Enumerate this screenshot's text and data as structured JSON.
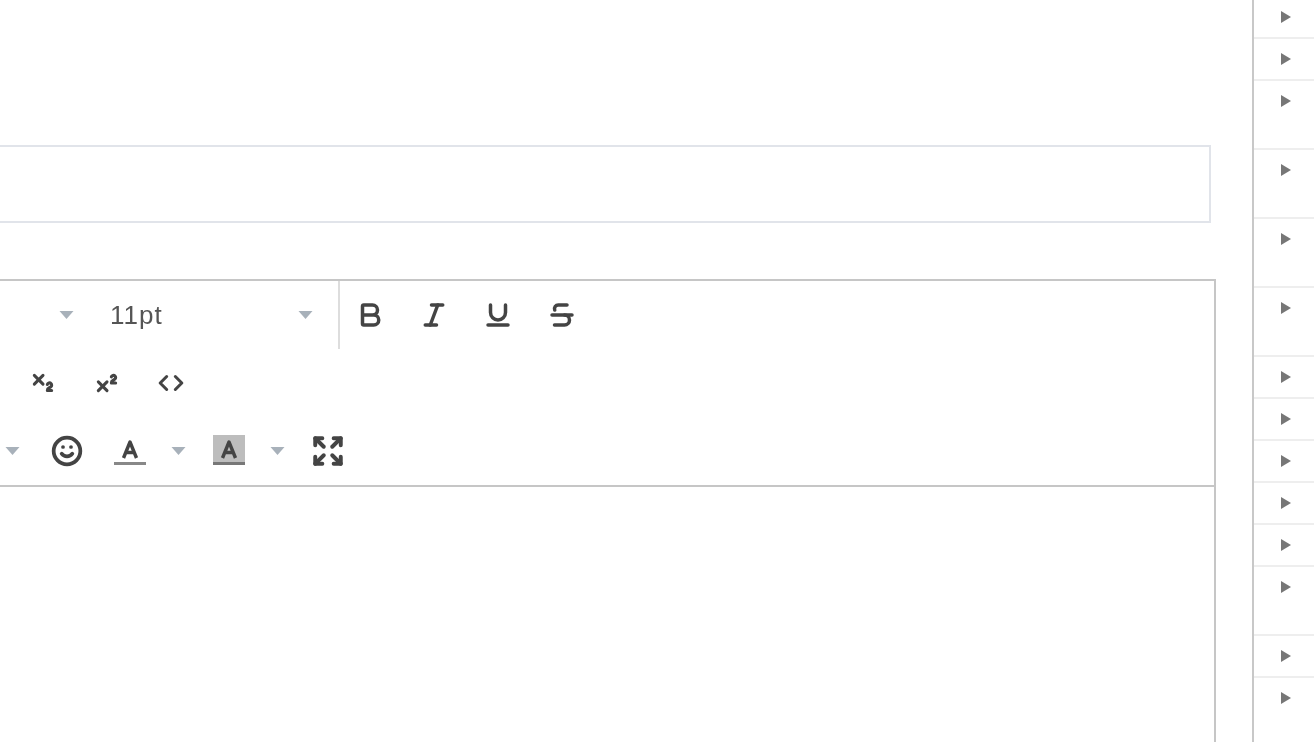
{
  "editor": {
    "toolbar": {
      "rows": [
        [
          {
            "kind": "caret"
          },
          {
            "kind": "select",
            "value": "11pt"
          },
          {
            "kind": "separator"
          },
          {
            "kind": "bold"
          },
          {
            "kind": "italic"
          },
          {
            "kind": "underline"
          },
          {
            "kind": "strikethrough"
          }
        ],
        [
          {
            "kind": "subscript"
          },
          {
            "kind": "superscript"
          },
          {
            "kind": "code"
          }
        ],
        [
          {
            "kind": "caret"
          },
          {
            "kind": "emoji"
          },
          {
            "kind": "text-color"
          },
          {
            "kind": "caret"
          },
          {
            "kind": "background-color"
          },
          {
            "kind": "caret"
          },
          {
            "kind": "fullscreen"
          }
        ]
      ]
    }
  },
  "tree": {
    "items": [
      {
        "kind": "single",
        "expanded": false
      },
      {
        "kind": "single",
        "expanded": false
      },
      {
        "kind": "double",
        "expanded": false
      },
      {
        "kind": "double",
        "expanded": false
      },
      {
        "kind": "double",
        "expanded": false
      },
      {
        "kind": "double",
        "expanded": false
      },
      {
        "kind": "single",
        "expanded": false
      },
      {
        "kind": "single",
        "expanded": false
      },
      {
        "kind": "single",
        "expanded": false
      },
      {
        "kind": "single",
        "expanded": false
      },
      {
        "kind": "single",
        "expanded": false
      },
      {
        "kind": "double",
        "expanded": false
      },
      {
        "kind": "single",
        "expanded": false
      },
      {
        "kind": "double",
        "expanded": false
      }
    ]
  }
}
